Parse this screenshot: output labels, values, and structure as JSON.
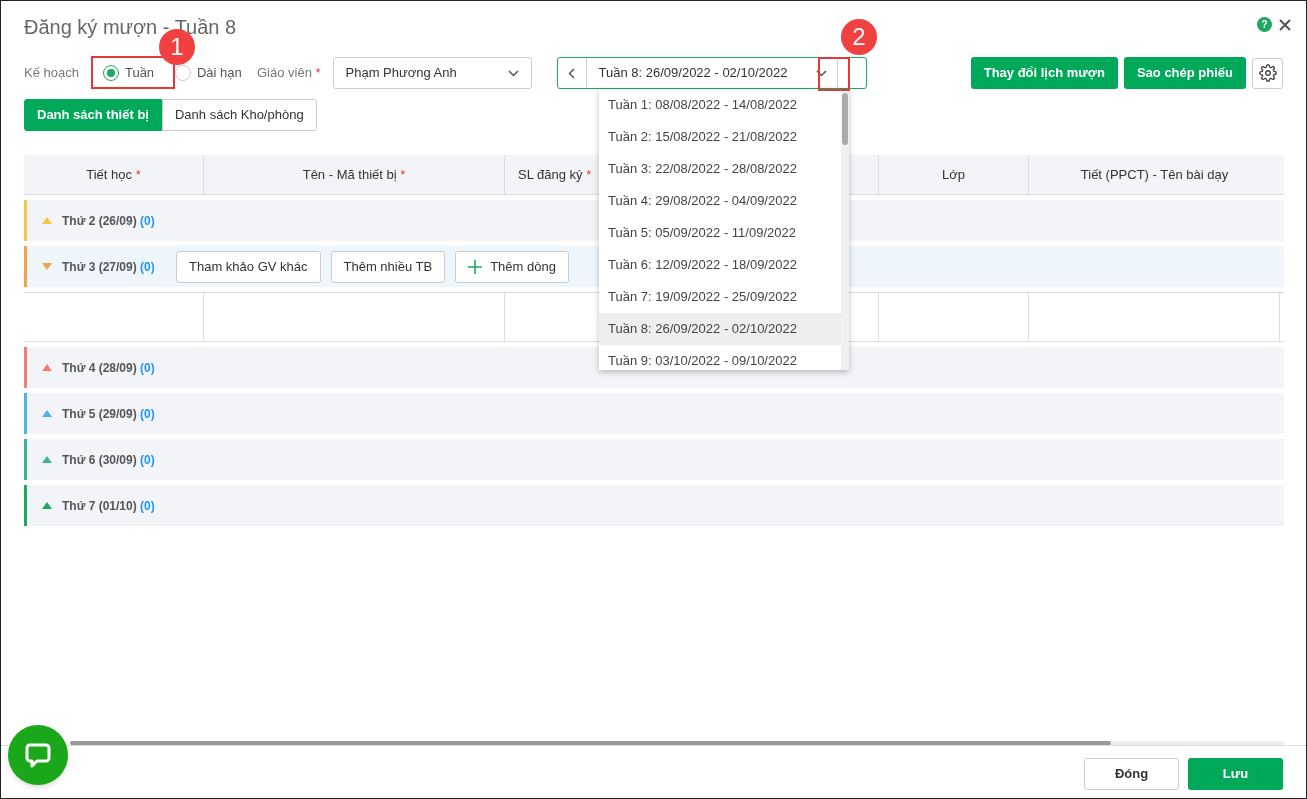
{
  "title": "Đăng ký mượn - Tuần 8",
  "help": "?",
  "plan": {
    "label": "Kế hoạch",
    "options": [
      {
        "label": "Tuần",
        "selected": true
      },
      {
        "label": "Dài hạn",
        "selected": false
      }
    ]
  },
  "teacher": {
    "label": "Giáo viên",
    "required": "*",
    "value": "Phạm Phương Anh"
  },
  "week": {
    "value": "Tuần 8: 26/09/2022 - 02/10/2022",
    "expanded": true,
    "options": [
      {
        "label": "Tuần 1: 08/08/2022 - 14/08/2022",
        "selected": false
      },
      {
        "label": "Tuần 2: 15/08/2022 - 21/08/2022",
        "selected": false
      },
      {
        "label": "Tuần 3: 22/08/2022 - 28/08/2022",
        "selected": false
      },
      {
        "label": "Tuần 4: 29/08/2022 - 04/09/2022",
        "selected": false
      },
      {
        "label": "Tuần 5: 05/09/2022 - 11/09/2022",
        "selected": false
      },
      {
        "label": "Tuần 6: 12/09/2022 - 18/09/2022",
        "selected": false
      },
      {
        "label": "Tuần 7: 19/09/2022 - 25/09/2022",
        "selected": false
      },
      {
        "label": "Tuần 8: 26/09/2022 - 02/10/2022",
        "selected": true
      },
      {
        "label": "Tuần 9: 03/10/2022 - 09/10/2022",
        "selected": false
      }
    ]
  },
  "actions": [
    "Thay đổi lịch mượn",
    "Sao chép phiếu"
  ],
  "tabs": [
    {
      "label": "Danh sách thiết bị",
      "selected": true
    },
    {
      "label": "Danh sách Kho/phòng",
      "selected": false
    }
  ],
  "columns": [
    {
      "label": "Tiết học",
      "required": "*"
    },
    {
      "label": "Tên - Mã thiết bị",
      "required": "*"
    },
    {
      "label": "SL đăng ký",
      "required": "*"
    },
    {},
    {
      "label": "Lớp"
    },
    {
      "label": "Tiết (PPCT) - Tên bài dạy"
    }
  ],
  "days": [
    {
      "label": "Thứ 2 (26/09)",
      "count": "(0)",
      "color": "#f5c842",
      "expanded": false
    },
    {
      "label": "Thứ 3 (27/09)",
      "count": "(0)",
      "color": "#f5a04a",
      "expanded": true
    },
    {
      "label": "Thứ 4 (28/09)",
      "count": "(0)",
      "color": "#f47c74",
      "expanded": false
    },
    {
      "label": "Thứ 5 (29/09)",
      "count": "(0)",
      "color": "#4fb0ee",
      "expanded": false
    },
    {
      "label": "Thứ 6 (30/09)",
      "count": "(0)",
      "color": "#3bb396",
      "expanded": false
    },
    {
      "label": "Thứ 7 (01/10)",
      "count": "(0)",
      "color": "#1fa861",
      "expanded": false
    }
  ],
  "day_actions": [
    "Tham khảo GV khác",
    "Thêm nhiều TB",
    "Thêm dòng"
  ],
  "callouts": [
    "1",
    "2"
  ],
  "footer": [
    "Đóng",
    "Lưu"
  ]
}
